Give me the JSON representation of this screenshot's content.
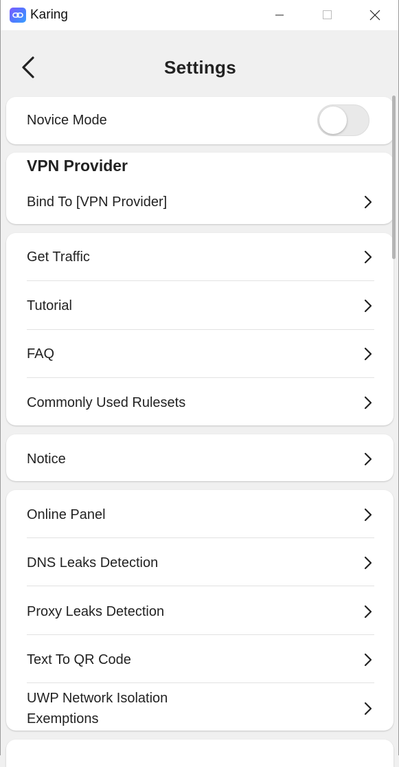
{
  "window": {
    "app_title": "Karing",
    "controls": [
      "minimize",
      "maximize",
      "close"
    ]
  },
  "header": {
    "title": "Settings",
    "back_icon": "chevron-left-icon"
  },
  "novice_mode": {
    "label": "Novice Mode",
    "enabled": false
  },
  "vpn_provider": {
    "title": "VPN Provider",
    "bind_label": "Bind To [VPN Provider]"
  },
  "group_help": {
    "items": [
      "Get Traffic",
      "Tutorial",
      "FAQ",
      "Commonly Used Rulesets"
    ]
  },
  "group_notice": {
    "items": [
      "Notice"
    ]
  },
  "group_tools": {
    "items": [
      "Online Panel",
      "DNS Leaks Detection",
      "Proxy Leaks Detection",
      "Text To QR Code",
      "UWP Network Isolation Exemptions"
    ]
  },
  "colors": {
    "background": "#f0f0f0",
    "card": "#ffffff",
    "text": "#222222",
    "toggle_track_off": "#e9e9e9"
  }
}
